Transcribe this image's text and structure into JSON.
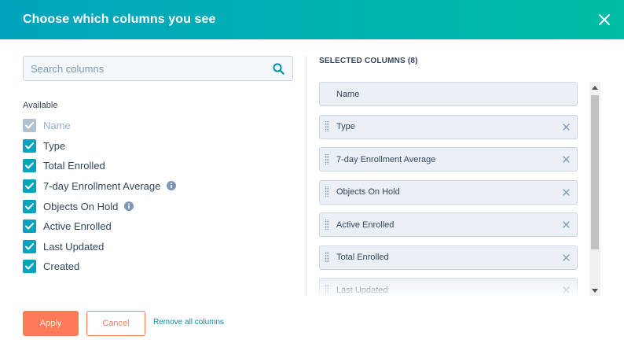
{
  "modal": {
    "title": "Choose which columns you see",
    "close_icon": "close-icon"
  },
  "search": {
    "placeholder": "Search columns",
    "value": "",
    "icon": "search-icon"
  },
  "available": {
    "label": "Available",
    "items": [
      {
        "label": "Name",
        "checked": true,
        "disabled": true,
        "info": false
      },
      {
        "label": "Type",
        "checked": true,
        "disabled": false,
        "info": false
      },
      {
        "label": "Total Enrolled",
        "checked": true,
        "disabled": false,
        "info": false
      },
      {
        "label": "7-day Enrollment Average",
        "checked": true,
        "disabled": false,
        "info": true
      },
      {
        "label": "Objects On Hold",
        "checked": true,
        "disabled": false,
        "info": true
      },
      {
        "label": "Active Enrolled",
        "checked": true,
        "disabled": false,
        "info": false
      },
      {
        "label": "Last Updated",
        "checked": true,
        "disabled": false,
        "info": false
      },
      {
        "label": "Created",
        "checked": true,
        "disabled": false,
        "info": false
      }
    ]
  },
  "selected": {
    "title": "SELECTED COLUMNS (8)",
    "items": [
      {
        "label": "Name",
        "locked": true
      },
      {
        "label": "Type",
        "locked": false
      },
      {
        "label": "7-day Enrollment Average",
        "locked": false
      },
      {
        "label": "Objects On Hold",
        "locked": false
      },
      {
        "label": "Active Enrolled",
        "locked": false
      },
      {
        "label": "Total Enrolled",
        "locked": false
      },
      {
        "label": "Last Updated",
        "locked": false
      }
    ]
  },
  "footer": {
    "apply_label": "Apply",
    "cancel_label": "Cancel",
    "remove_all_label": "Remove all columns"
  },
  "colors": {
    "header_start": "#00a4bd",
    "header_end": "#00bda5",
    "checkbox": "#00a4bd",
    "primary_button": "#ff7a59",
    "link": "#0091ae",
    "text": "#33475b"
  }
}
